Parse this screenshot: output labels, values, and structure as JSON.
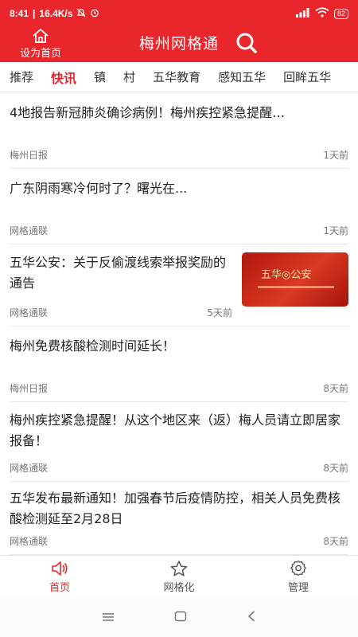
{
  "status_bar": {
    "time": "8:41",
    "net_speed": "16.4K/s",
    "battery": "82"
  },
  "header": {
    "home_label": "设为首页",
    "title": "梅州网格通"
  },
  "tabs": [
    "推荐",
    "快讯",
    "镇",
    "村",
    "五华教育",
    "感知五华",
    "回眸五华"
  ],
  "active_tab": "快讯",
  "feed": [
    {
      "title": "4地报告新冠肺炎确诊病例！梅州疾控紧急提醒…",
      "source": "梅州日报",
      "time": "1天前"
    },
    {
      "title": "广东阴雨寒冷何时了？曙光在...",
      "source": "网格通联",
      "time": "1天前"
    },
    {
      "title": "五华公安：关于反偷渡线索举报奖励的通告",
      "source": "网格通联",
      "time": "5天前",
      "thumb_text": "五华◎公安"
    },
    {
      "title": "梅州免费核酸检测时间延长！",
      "source": "梅州日报",
      "time": "8天前"
    },
    {
      "title": "梅州疾控紧急提醒！从这个地区来（返）梅人员请立即居家报备！",
      "source": "网格通联",
      "time": "8天前"
    },
    {
      "title": "五华发布最新通知！加强春节后疫情防控，相关人员免费核酸检测延至2月28日",
      "source": "网格通联",
      "time": "8天前"
    }
  ],
  "bottom_nav": [
    {
      "label": "首页",
      "icon": "speaker-icon"
    },
    {
      "label": "网格化",
      "icon": "star-icon"
    },
    {
      "label": "管理",
      "icon": "gear-icon"
    }
  ],
  "colors": {
    "brand": "#e8262b"
  }
}
